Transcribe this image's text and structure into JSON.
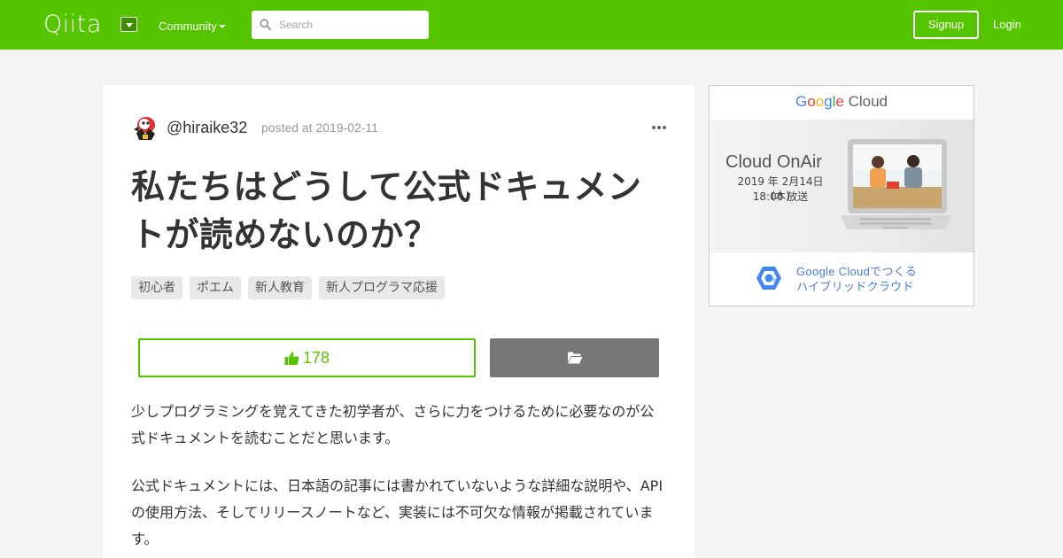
{
  "header": {
    "logo": "Qiita",
    "community_label": "Community",
    "search_placeholder": "Search",
    "signup_label": "Signup",
    "login_label": "Login",
    "brand_color": "#55c500"
  },
  "article": {
    "author": "@hiraike32",
    "posted": "posted at 2019-02-11",
    "title": "私たちはどうして公式ドキュメントが読めないのか？",
    "tags": [
      "初心者",
      "ポエム",
      "新人教育",
      "新人プログラマ応援"
    ],
    "likes": "178",
    "paragraphs": [
      "少しプログラミングを覚えてきた初学者が、さらに力をつけるために必要なのが公式ドキュメントを読むことだと思います。",
      "公式ドキュメントには、日本語の記事には書かれていないような詳細な説明や、APIの使用方法、そしてリリースノートなど、実装には不可欠な情報が掲載されています。"
    ]
  },
  "ad": {
    "brand_google": "Google",
    "brand_cloud": "Cloud",
    "onair": "Cloud OnAir",
    "date": "2019 年 2月14日 (木)",
    "time": "18:00 放送",
    "footer_line1": "Google Cloudでつくる",
    "footer_line2": "ハイブリッドクラウド"
  }
}
